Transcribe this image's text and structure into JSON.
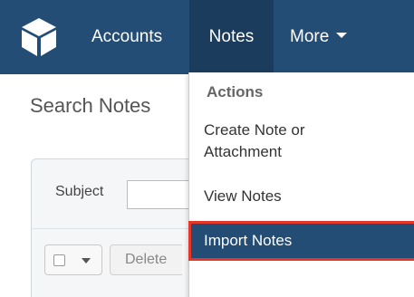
{
  "nav": {
    "logo_icon": "cube-logo-icon",
    "items": [
      {
        "label": "Accounts"
      },
      {
        "label": "Notes"
      },
      {
        "label": "More"
      }
    ],
    "active": "Notes",
    "colors": {
      "bar": "#234d74",
      "active": "#1b3c5c"
    }
  },
  "page": {
    "title": "Search Notes"
  },
  "search": {
    "subject_label": "Subject",
    "subject_value": ""
  },
  "toolbar": {
    "delete_label": "Delete"
  },
  "dropdown": {
    "header": "Actions",
    "items": [
      {
        "label_line1": "Create Note or",
        "label_line2": "Attachment"
      },
      {
        "label": "View Notes"
      },
      {
        "label": "Import Notes",
        "highlighted": true
      }
    ],
    "highlight_color": "#e4372a"
  }
}
